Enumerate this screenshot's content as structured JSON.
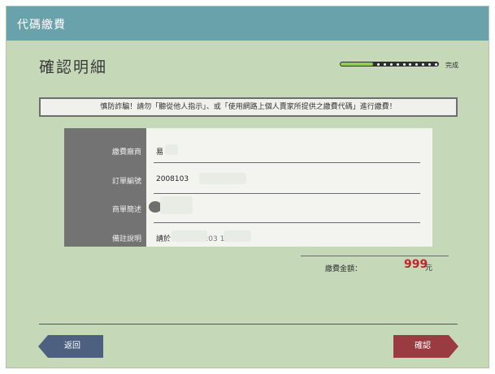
{
  "header": {
    "title": "代碼繳費"
  },
  "page": {
    "title": "確認明細"
  },
  "progress": {
    "label": "完成",
    "value": 0.33
  },
  "warning": {
    "text": "慎防詐騙！請勿「聽從他人指示」、或「使用網路上個人賣家所提供之繳費代碼」進行繳費！"
  },
  "details": {
    "rows": [
      {
        "label": "繳費廠商",
        "value": "易"
      },
      {
        "label": "訂單編號",
        "value": "2008103"
      },
      {
        "label": "商單簡述",
        "value": ""
      },
      {
        "label": "備註說明",
        "value": "請於"
      }
    ],
    "remark_tail": "11:03 15:10"
  },
  "total": {
    "label": "繳費金額：",
    "amount": "999",
    "unit": "元"
  },
  "buttons": {
    "back": "返回",
    "confirm": "確認"
  },
  "colors": {
    "header_bg": "#6aa2ab",
    "page_bg": "#c5d8b8",
    "amount": "#c0242d",
    "back_button": "#4d607f",
    "confirm_button": "#9a3a41"
  }
}
